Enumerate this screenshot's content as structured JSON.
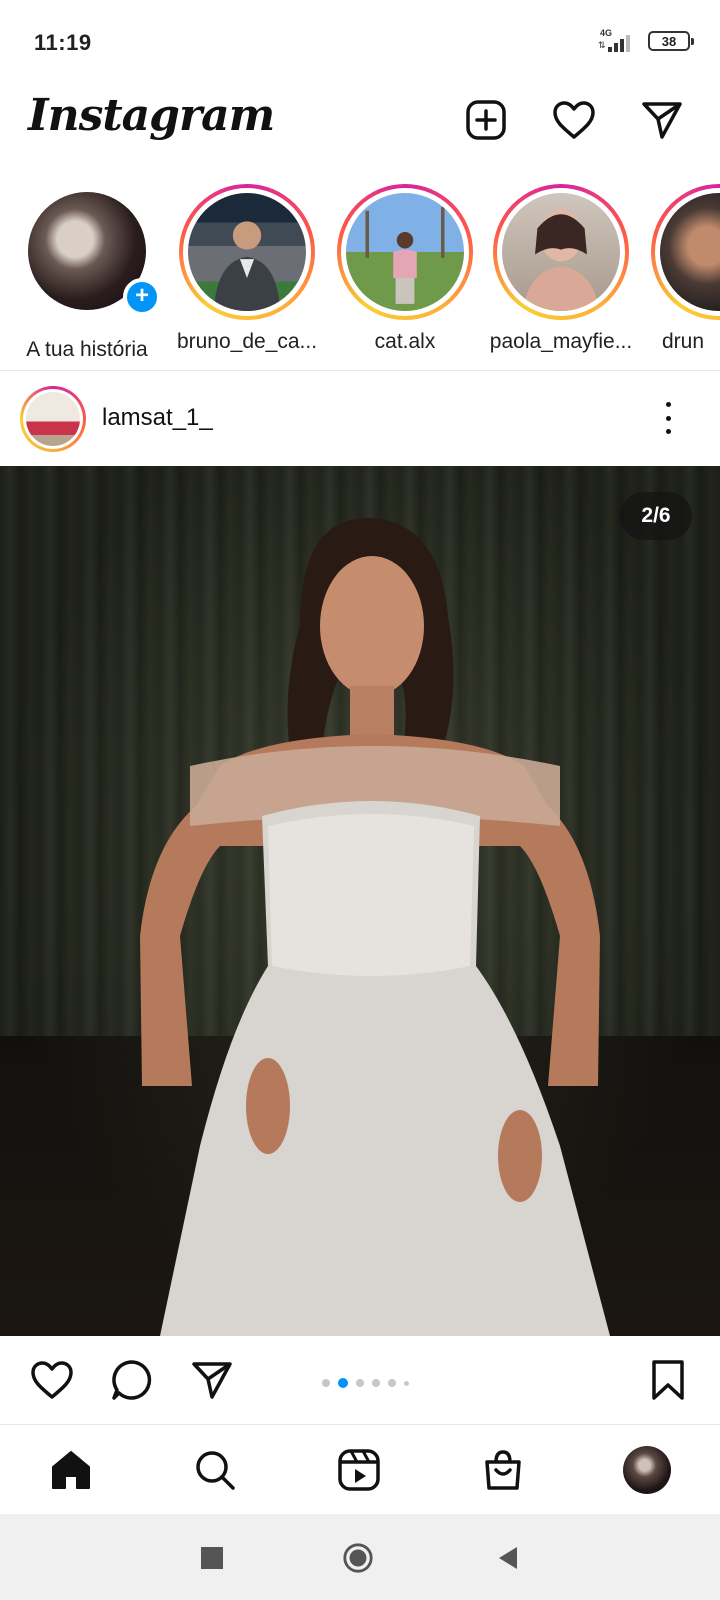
{
  "status_bar": {
    "time": "11:19",
    "network": "4G",
    "battery": "38"
  },
  "header": {
    "logo": "Instagram",
    "icons": [
      "new-post-icon",
      "heart-icon",
      "direct-message-icon"
    ]
  },
  "stories": [
    {
      "label": "A tua história",
      "own": true
    },
    {
      "label": "bruno_de_ca..."
    },
    {
      "label": "cat.alx"
    },
    {
      "label": "paola_mayfie..."
    },
    {
      "label": "drun"
    }
  ],
  "post": {
    "username": "lamsat_1_",
    "page_counter": "2/6",
    "carousel": {
      "current": 2,
      "total": 6
    }
  },
  "colors": {
    "accent": "#0095f6",
    "story_ring": [
      "#d6249f",
      "#fd5949",
      "#fdae3a",
      "#f9ce34"
    ]
  }
}
